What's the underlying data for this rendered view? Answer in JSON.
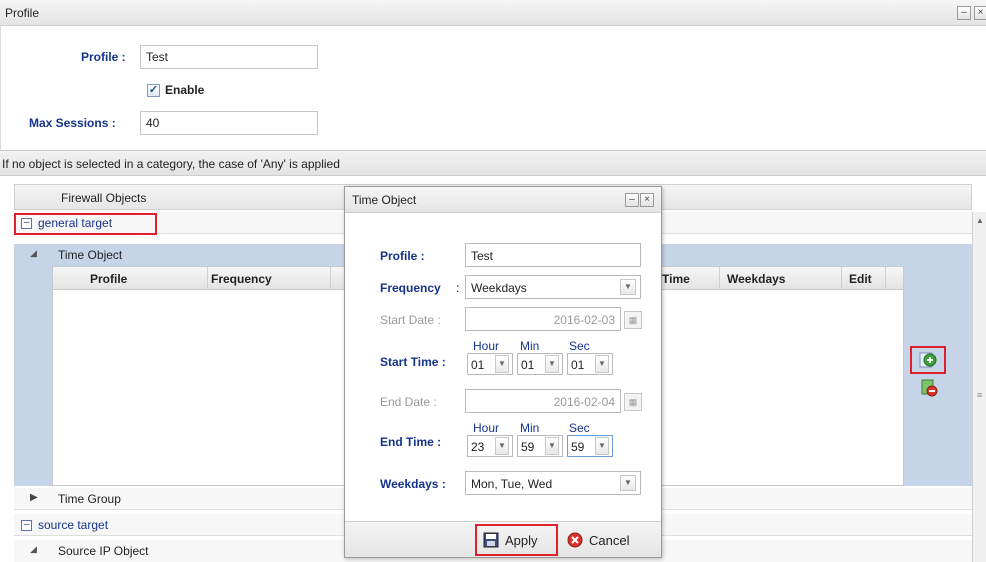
{
  "window": {
    "title": "Profile",
    "minimize_icon": "–",
    "close_icon": "×"
  },
  "form": {
    "profile_label": "Profile :",
    "profile_value": "Test",
    "enable_label": "Enable",
    "enable_checked": true,
    "max_sessions_label": "Max Sessions :",
    "max_sessions_value": "40"
  },
  "info_text": "If no object is selected in a category, the case of 'Any' is applied",
  "grid": {
    "header": "Firewall Objects",
    "group_general": "general target",
    "time_object_row": "Time Object",
    "columns": [
      "Profile",
      "Frequency",
      "Time",
      "Weekdays",
      "Edit"
    ],
    "time_group_row": "Time Group",
    "group_source": "source target",
    "source_ip_row": "Source IP Object"
  },
  "modal": {
    "title": "Time Object",
    "profile_label": "Profile :",
    "profile_value": "Test",
    "frequency_label": "Frequency",
    "frequency_colon": ":",
    "frequency_value": "Weekdays",
    "start_date_label": "Start Date :",
    "start_date_value": "2016-02-03",
    "start_time_label": "Start Time :",
    "end_date_label": "End Date :",
    "end_date_value": "2016-02-04",
    "end_time_label": "End Time :",
    "hour_label": "Hour",
    "min_label": "Min",
    "sec_label": "Sec",
    "start_hour": "01",
    "start_min": "01",
    "start_sec": "01",
    "end_hour": "23",
    "end_min": "59",
    "end_sec": "59",
    "weekdays_label": "Weekdays :",
    "weekdays_value": "Mon, Tue, Wed",
    "apply_label": "Apply",
    "cancel_label": "Cancel"
  },
  "colors": {
    "label_blue": "#15338a",
    "highlight_red": "#e0202a",
    "selection_blue": "#c6d4e8"
  }
}
